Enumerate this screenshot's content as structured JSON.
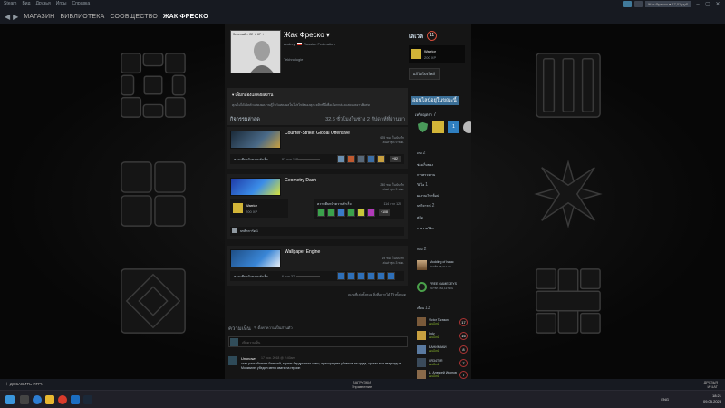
{
  "titlebar": {
    "menu": [
      "Steam",
      "Вид",
      "Друзья",
      "Игры",
      "Справка"
    ],
    "user": "Жак Фреско ▾ 17,01 руб."
  },
  "nav": {
    "items": [
      "МАГАЗИН",
      "БИБЛИОТЕКА",
      "СООБЩЕСТВО",
      "ЖАК ФРЕСКО"
    ]
  },
  "profile": {
    "avatar_caption": "Зеленый  ≈ 22 ✦ 67 ✧",
    "name": "Жак Фреско ▾",
    "nick": "Andrey",
    "country": "Russian Federation",
    "summary": "Tekhnologie"
  },
  "level": {
    "title": "เลเวล",
    "value": "11",
    "badge_name": "Warrior",
    "badge_xp": "200 XP",
    "edit_label": "แก้ไขโปรไฟล์"
  },
  "showcase": {
    "title": "▾ เพิ่มกล่องแสดงผลงาน",
    "text": "คุณไม่ได้เปิดตัวแสดงผลงานตู้โชว์แสดงผลในโปรไฟล์ของคุณ คลิกที่นี่เพื่อเลือกกล่องแสดงผลงานพิเศษ"
  },
  "activity": {
    "title": "กิจกรรมล่าสุด",
    "hours": "32.6 ชั่วโมงในช่วง 2 สัปดาห์ที่ผ่านมา"
  },
  "games": [
    {
      "name": "Counter-Strike: Global Offensive",
      "hours_total": "625 ชม. ในบันทึก",
      "last_played": "เล่นล่าสุด 9 พ.ค.",
      "ach_label": "ความคืบหน้าความสำเร็จ",
      "ach_count": "87 จาก 167",
      "ach_more": "+82"
    },
    {
      "name": "Geometry Dash",
      "hours_total": "240 ชม. ในบันทึก",
      "last_played": "เล่นล่าสุด 9 พ.ค.",
      "badge_name": "Warrior",
      "badge_xp": "200 XP",
      "ach_label": "ความคืบหน้าความสำเร็จ",
      "ach_count": "114 จาก 120",
      "ach_more": "+108",
      "card_label": "บทสิกการ์ด 1"
    },
    {
      "name": "Wallpaper Engine",
      "hours_total": "19 ชม. ในบันทึก",
      "last_played": "เล่นล่าสุด 3 พ.ค.",
      "ach_label": "ความคืบหน้าความสำเร็จ",
      "ach_count": "6 จาก 37"
    }
  ],
  "links": "ดูเกมที่เล่นทั้งหมด   สิ่งที่อยากได้   รีวิวทั้งหมด",
  "comments": {
    "title": "ความเห็น",
    "subtitle": "✎ ตั้งค่าความเป็นส่วนตัว",
    "placeholder": "เพิ่มความเห็น",
    "items": [
      {
        "name": "Unknown",
        "date": "17 ноя. 2018 @ 2:40am",
        "text": "стар разъебывает блевоей, корнет бердрыным щипо, прихорадает ублюков на груда, крокат-мза квартиру в Москвиле, убедил меня свать на героин"
      }
    ]
  },
  "right": {
    "online": "ออนไลน์อยู่ในขณะนี้",
    "badges_label": "เหรียญตรา",
    "badges_count": "7",
    "games_label": "เกม",
    "games_count": "2",
    "inventory": "ช่องเก็บของ",
    "trade": "การตรวจงาน",
    "videos_label": "วิดีโอ",
    "videos_count": "1",
    "workshop": "ผลงานเวิร์กช็อป",
    "reviews_label": "บทวิจารณ์",
    "reviews_count": "2",
    "guides": "คู่มือ",
    "artwork": "งานวาดวิจิต",
    "groups_label": "กลุ่ม",
    "groups_count": "2",
    "groups": [
      {
        "name": "Modding of Isaac",
        "members": "สมาชิก 85,012 คน"
      },
      {
        "name": "FREE GAMEKEYS",
        "members": "สมาชิก 162,127 คน"
      }
    ],
    "friends_label": "เพื่อน",
    "friends_count": "13",
    "friends": [
      {
        "name": "Victor Tarasov",
        "status": "ออนไลน์",
        "level": "17"
      },
      {
        "name": "Indy",
        "status": "ออนไลน์",
        "level": "16"
      },
      {
        "name": "ЕАНИМАКИ",
        "status": "ออนไลน์",
        "level": "8"
      },
      {
        "name": "CR34T0R",
        "status": "ออนไลน์",
        "level": "7"
      },
      {
        "name": "Д. Алексей Ивонов",
        "status": "ออนไลน์",
        "level": "7"
      }
    ]
  },
  "bottombar": {
    "add_game": "ДОБАВИТЬ ИГРУ",
    "downloads_title": "ЗАГРУЗКИ",
    "downloads_sub": "Управление",
    "friends_title": "ДРУЗЬЯ",
    "friends_sub": "И ЧАТ"
  },
  "taskbar": {
    "lang": "ENG",
    "time": "18:21",
    "date": "09.05.2023"
  }
}
